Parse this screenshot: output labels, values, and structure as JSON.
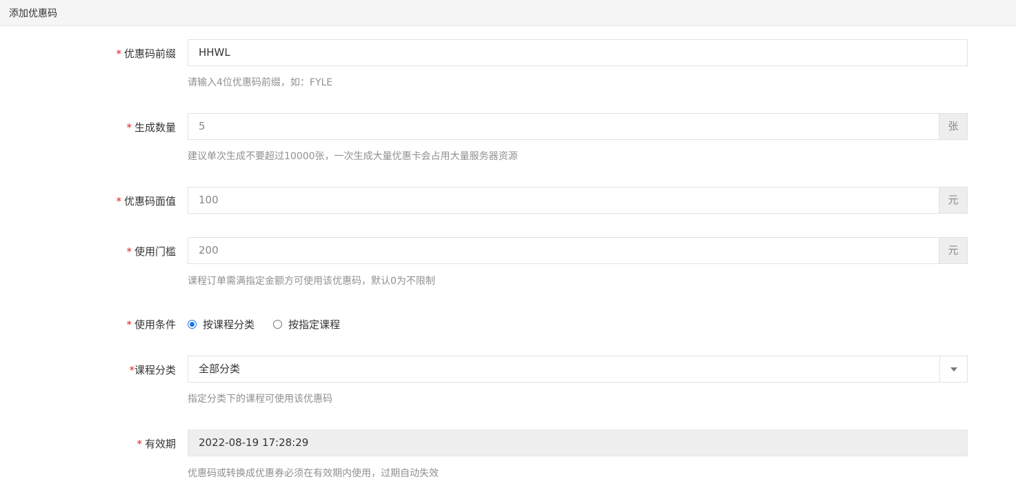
{
  "header": {
    "title": "添加优惠码"
  },
  "form": {
    "prefix": {
      "label": "优惠码前缀",
      "value": "HHWL",
      "help": "请输入4位优惠码前缀，如：FYLE"
    },
    "quantity": {
      "label": "生成数量",
      "value": "5",
      "unit": "张",
      "help": "建议单次生成不要超过10000张，一次生成大量优惠卡会占用大量服务器资源"
    },
    "face_value": {
      "label": "优惠码面值",
      "value": "100",
      "unit": "元"
    },
    "threshold": {
      "label": "使用门槛",
      "value": "200",
      "unit": "元",
      "help": "课程订单需满指定金额方可使用该优惠码，默认0为不限制"
    },
    "condition": {
      "label": "使用条件",
      "options": [
        {
          "label": "按课程分类",
          "checked": true
        },
        {
          "label": "按指定课程",
          "checked": false
        }
      ]
    },
    "category": {
      "label": "课程分类",
      "selected": "全部分类",
      "help": "指定分类下的课程可使用该优惠码"
    },
    "validity": {
      "label": "有效期",
      "value": "2022-08-19 17:28:29",
      "help": "优惠码或转换成优惠券必须在有效期内使用，过期自动失效"
    }
  },
  "colors": {
    "required_mark": "#e02020",
    "radio_accent": "#1a73e8",
    "help_text": "#909090"
  },
  "icons": {
    "select_arrow": "chevron-down-icon"
  }
}
